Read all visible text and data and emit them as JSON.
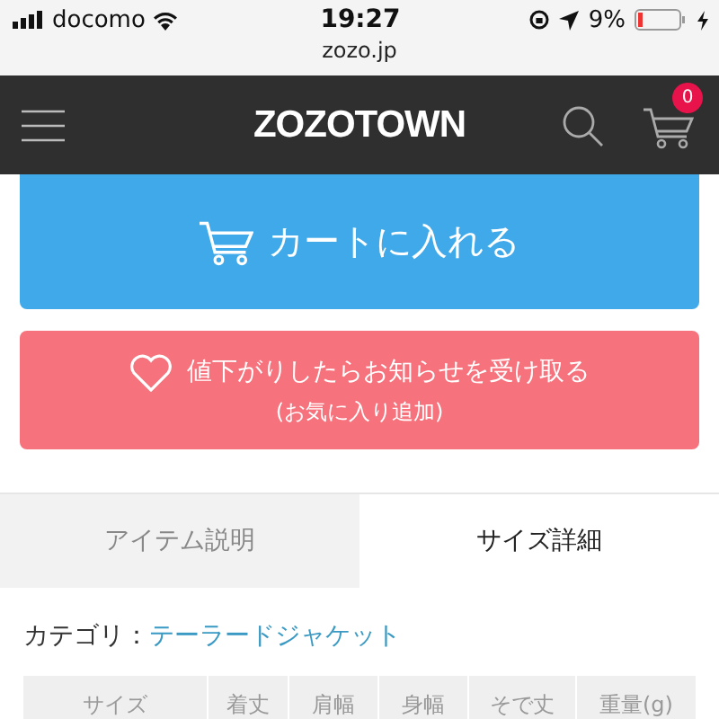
{
  "status_bar": {
    "carrier": "docomo",
    "time": "19:27",
    "url": "zozo.jp",
    "battery": "9%"
  },
  "nav": {
    "logo": "ZOZOTOWN",
    "cart_count": "0"
  },
  "buttons": [
    {
      "kind": "cart",
      "label": "カートに入れる"
    },
    {
      "kind": "favorite",
      "label": "値下がりしたらお知らせを受け取る",
      "sublabel": "(お気に入り追加)"
    }
  ],
  "tabs": [
    {
      "label": "アイテム説明",
      "selected": false
    },
    {
      "label": "サイズ詳細",
      "selected": true
    }
  ],
  "category": {
    "label": "カテゴリ：",
    "value": "テーラードジャケット"
  },
  "table": {
    "columns": [
      "サイズ",
      "着丈",
      "肩幅",
      "身幅",
      "そで丈",
      "重量(g)"
    ]
  }
}
